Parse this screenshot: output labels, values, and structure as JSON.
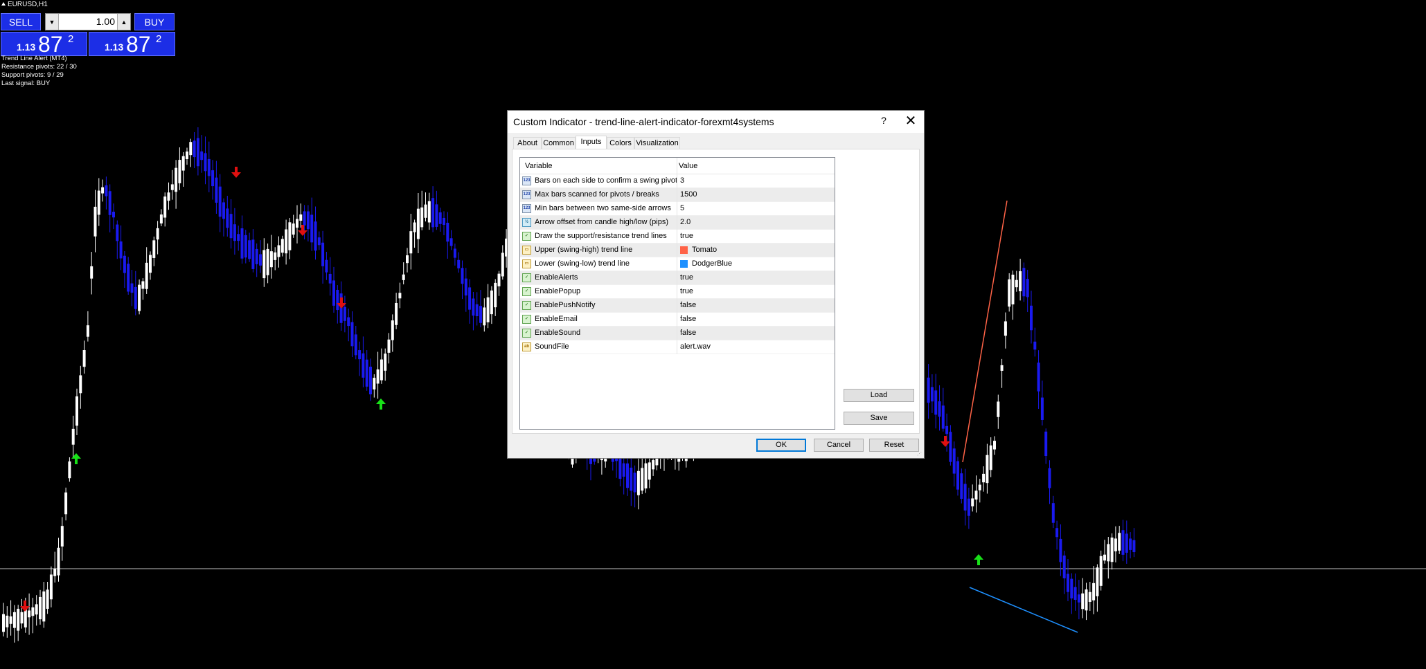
{
  "symbol": "EURUSD,H1",
  "trade_panel": {
    "sell_label": "SELL",
    "buy_label": "BUY",
    "lot_value": "1.00",
    "bid": {
      "prefix": "1.13",
      "big": "87",
      "sup": "2"
    },
    "ask": {
      "prefix": "1.13",
      "big": "87",
      "sup": "2"
    }
  },
  "indicator_info": {
    "line1": "Trend Line Alert (MT4)",
    "line2": "Resistance pivots: 22 / 30",
    "line3": "Support pivots: 9 / 29",
    "line4": "Last signal: BUY"
  },
  "colors": {
    "bull_candle": "#ffffff",
    "bear_candle": "#1a1af0",
    "up_arrow": "#18e018",
    "down_arrow": "#e01010",
    "upper_trendline": "#ff6347",
    "lower_trendline": "#1e90ff",
    "price_line": "#c0c0c0"
  },
  "dialog": {
    "title": "Custom Indicator - trend-line-alert-indicator-forexmt4systems",
    "help": "?",
    "close": "✕",
    "tabs": [
      "About",
      "Common",
      "Inputs",
      "Colors",
      "Visualization"
    ],
    "active_tab": "Inputs",
    "columns": {
      "variable": "Variable",
      "value": "Value"
    },
    "params": [
      {
        "icon": "123",
        "type": "int",
        "name": "Bars on each side to confirm a swing pivot",
        "value": "3"
      },
      {
        "icon": "123",
        "type": "int",
        "name": "Max bars scanned for pivots / breaks",
        "value": "1500"
      },
      {
        "icon": "123",
        "type": "int",
        "name": "Min bars between two same-side arrows",
        "value": "5"
      },
      {
        "icon": "½",
        "type": "dbl",
        "name": "Arrow offset from candle high/low (pips)",
        "value": "2.0"
      },
      {
        "icon": "✓",
        "type": "bool",
        "name": "Draw the support/resistance trend lines",
        "value": "true"
      },
      {
        "icon": "▭",
        "type": "col",
        "name": "Upper (swing-high) trend line",
        "value": "Tomato",
        "swatch": "#ff6347"
      },
      {
        "icon": "▭",
        "type": "col",
        "name": "Lower (swing-low) trend line",
        "value": "DodgerBlue",
        "swatch": "#1e90ff"
      },
      {
        "icon": "✓",
        "type": "bool",
        "name": "EnableAlerts",
        "value": "true"
      },
      {
        "icon": "✓",
        "type": "bool",
        "name": "EnablePopup",
        "value": "true"
      },
      {
        "icon": "✓",
        "type": "bool",
        "name": "EnablePushNotify",
        "value": "false"
      },
      {
        "icon": "✓",
        "type": "bool",
        "name": "EnableEmail",
        "value": "false"
      },
      {
        "icon": "✓",
        "type": "bool",
        "name": "EnableSound",
        "value": "false"
      },
      {
        "icon": "ab",
        "type": "str",
        "name": "SoundFile",
        "value": "alert.wav"
      }
    ],
    "load_label": "Load",
    "save_label": "Save",
    "ok_label": "OK",
    "cancel_label": "Cancel",
    "reset_label": "Reset"
  }
}
